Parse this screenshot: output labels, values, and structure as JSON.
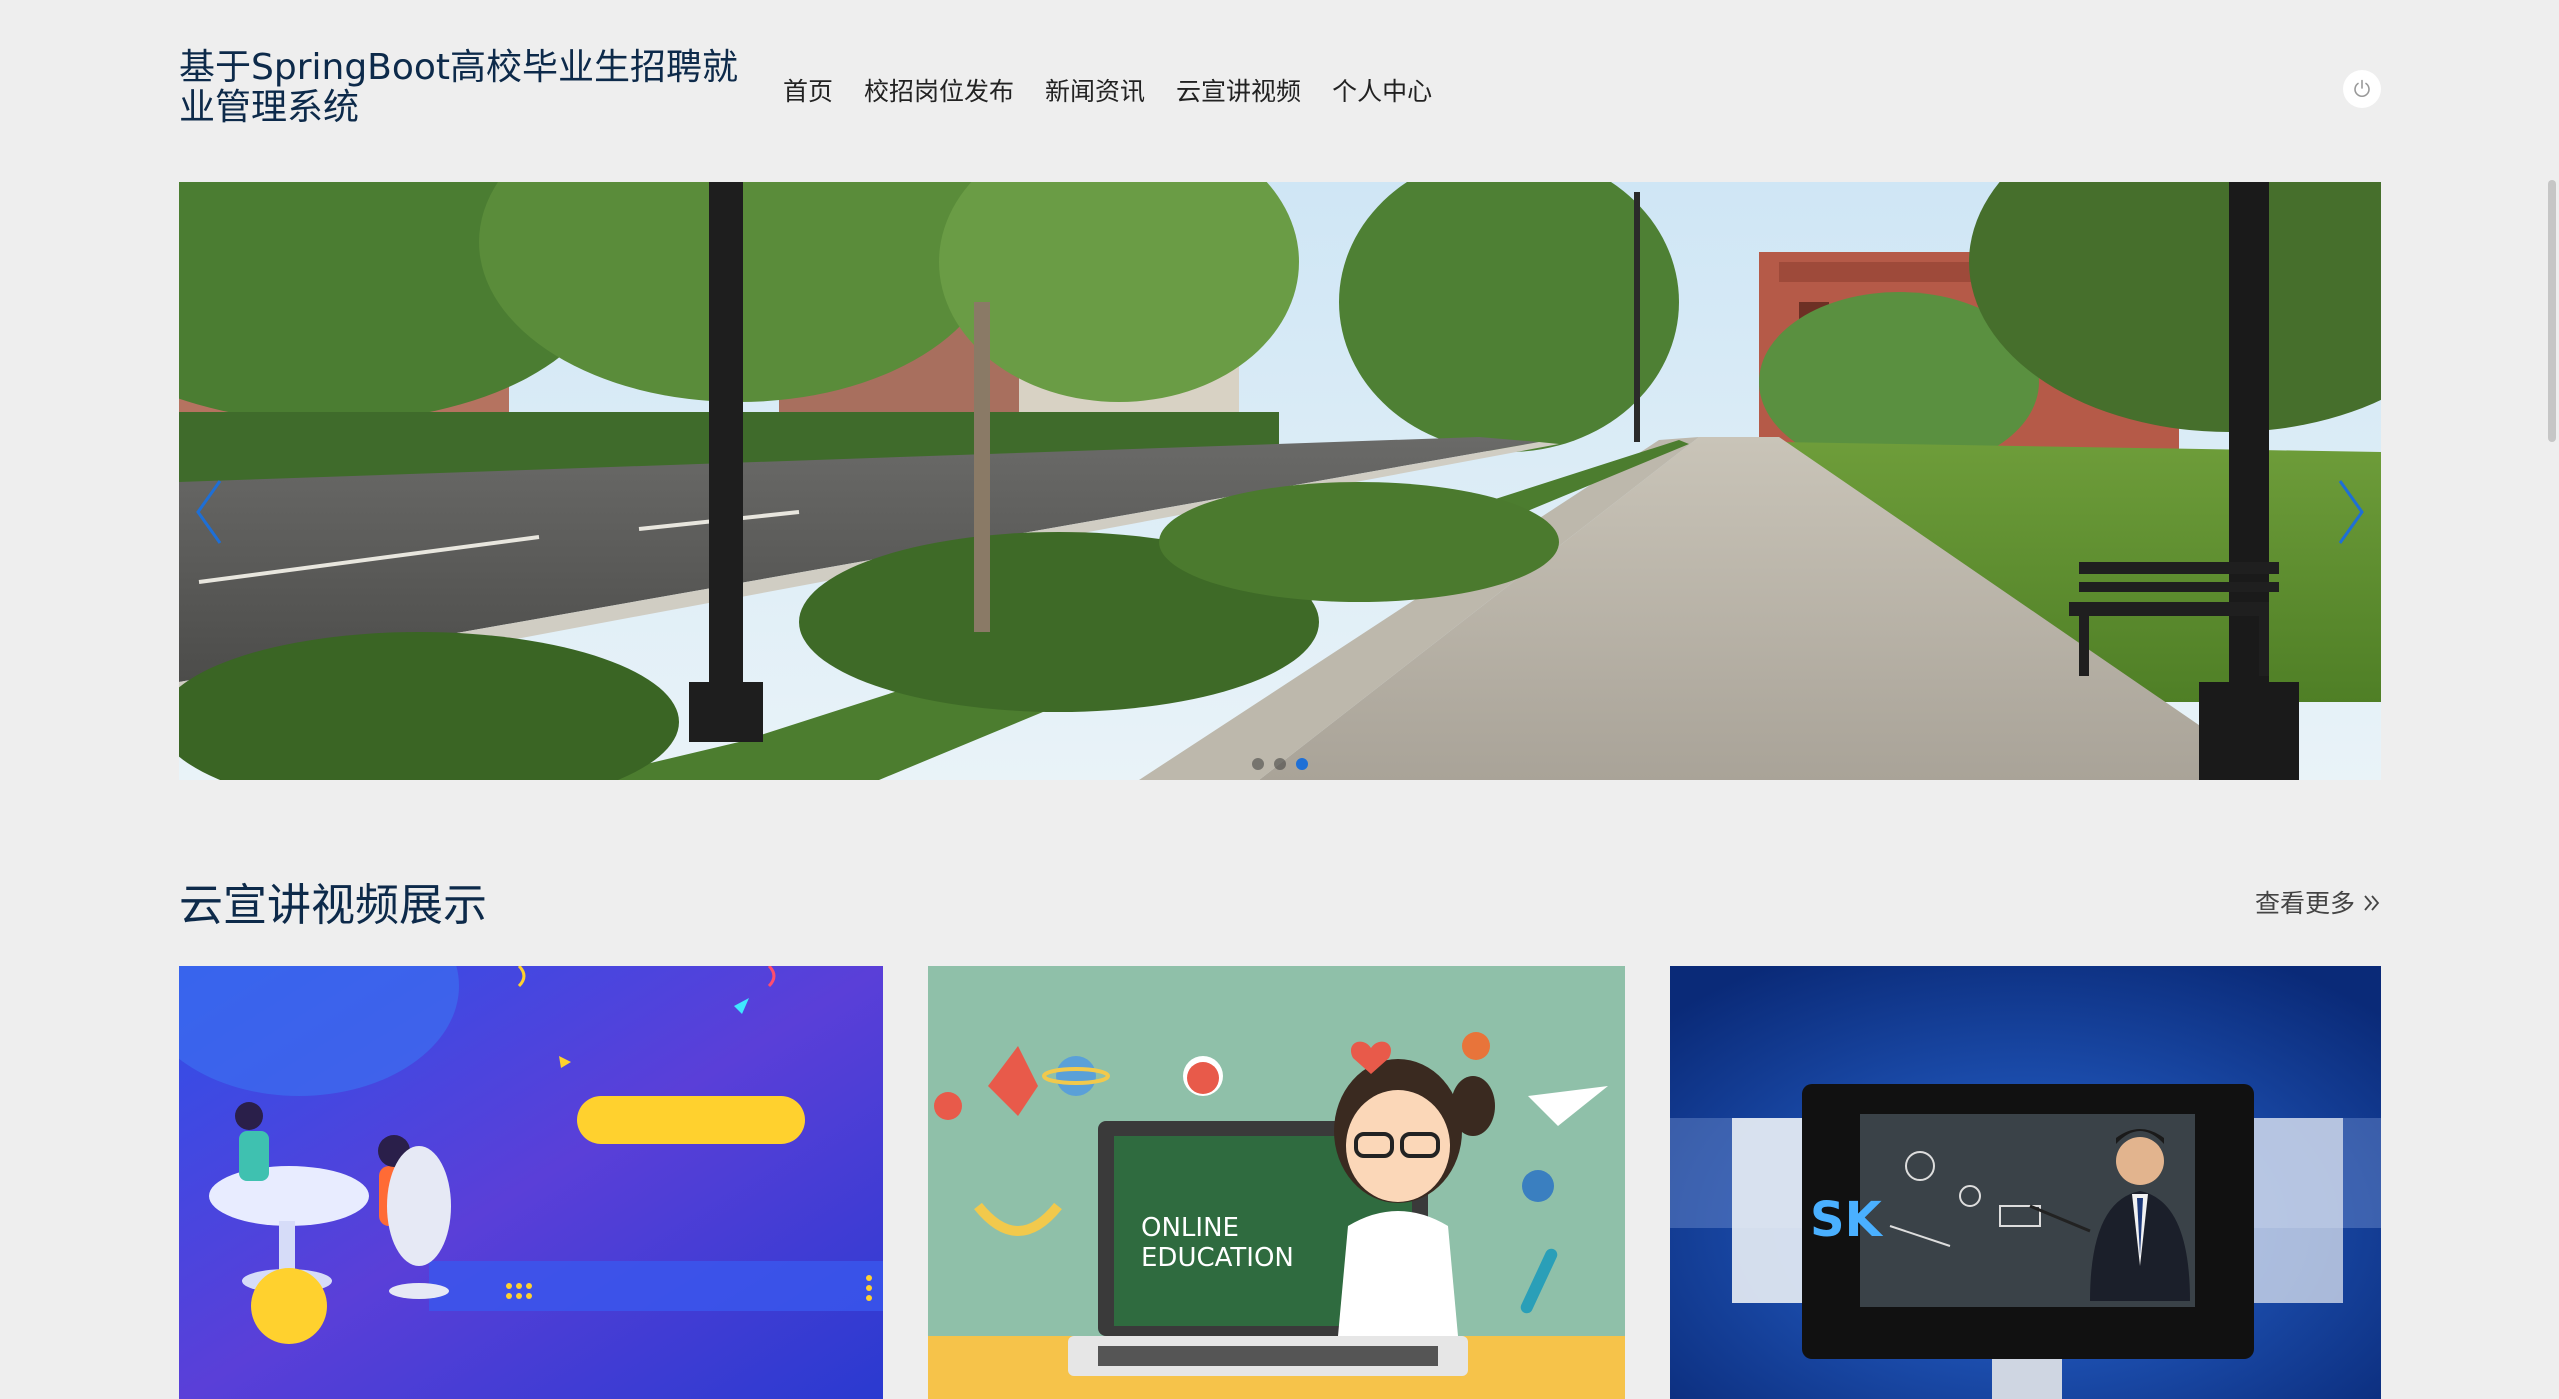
{
  "header": {
    "title": "基于SpringBoot高校毕业生招聘就业管理系统",
    "nav": [
      "首页",
      "校招岗位发布",
      "新闻资讯",
      "云宣讲视频",
      "个人中心"
    ],
    "power_icon": "power-icon"
  },
  "banner": {
    "slide_count": 3,
    "active_index": 2,
    "prev_icon": "chevron-left-icon",
    "next_icon": "chevron-right-icon"
  },
  "section": {
    "title": "云宣讲视频展示",
    "more_label": "查看更多",
    "more_icon": "double-chevron-right-icon"
  },
  "cards": [
    {
      "image": "meeting-illustration"
    },
    {
      "image": "online-education-illustration",
      "text_line1": "ONLINE",
      "text_line2": "EDUCATION"
    },
    {
      "image": "teacher-presentation-photo",
      "text": "SK"
    }
  ],
  "colors": {
    "background": "#eeeeee",
    "title": "#0d2a4a",
    "accent": "#1e6fd6"
  }
}
